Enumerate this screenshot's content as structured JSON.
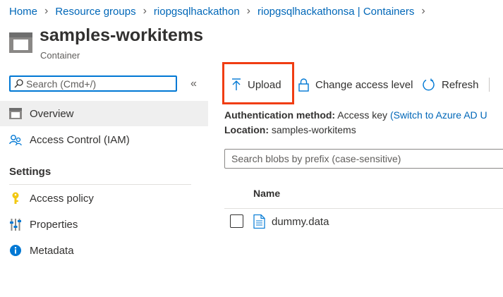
{
  "breadcrumb": [
    {
      "label": "Home"
    },
    {
      "label": "Resource groups"
    },
    {
      "label": "riopgsqlhackathon"
    },
    {
      "label": "riopgsqlhackathonsa | Containers"
    }
  ],
  "header": {
    "title": "samples-workitems",
    "subtitle": "Container"
  },
  "sidebar": {
    "search_placeholder": "Search (Cmd+/)",
    "collapse_label": "«",
    "items": [
      {
        "label": "Overview",
        "icon": "container-icon",
        "selected": true
      },
      {
        "label": "Access Control (IAM)",
        "icon": "people-icon"
      }
    ],
    "section": {
      "title": "Settings",
      "items": [
        {
          "label": "Access policy",
          "icon": "key-icon"
        },
        {
          "label": "Properties",
          "icon": "sliders-icon"
        },
        {
          "label": "Metadata",
          "icon": "info-icon"
        }
      ]
    }
  },
  "toolbar": {
    "upload_label": "Upload",
    "change_access_label": "Change access level",
    "refresh_label": "Refresh"
  },
  "info": {
    "auth_label": "Authentication method:",
    "auth_value": "Access key",
    "auth_link": "(Switch to Azure AD U",
    "location_label": "Location:",
    "location_value": "samples-workitems"
  },
  "blobs": {
    "search_placeholder": "Search blobs by prefix (case-sensitive)",
    "column_name": "Name",
    "rows": [
      {
        "name": "dummy.data"
      }
    ]
  },
  "colors": {
    "link": "#0067b8",
    "accent": "#0078d4",
    "highlight": "#f03d12",
    "selected_bg": "#efefef"
  }
}
